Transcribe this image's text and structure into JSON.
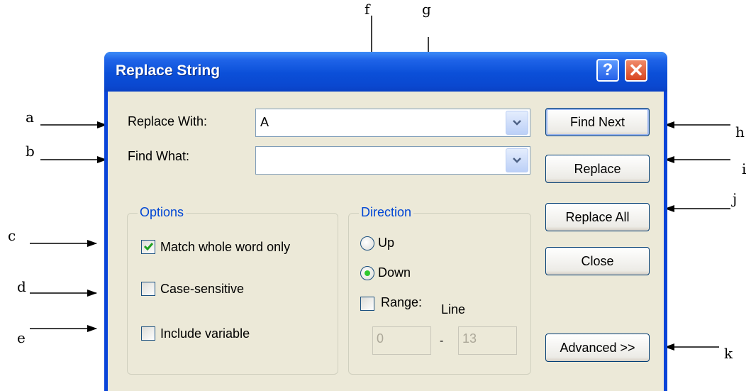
{
  "dialog": {
    "title": "Replace String",
    "help_label": "?",
    "close_label": "✕"
  },
  "fields": {
    "replace_with_label": "Replace With:",
    "replace_with_value": "A",
    "find_what_label": "Find What:",
    "find_what_value": ""
  },
  "options": {
    "legend": "Options",
    "match_whole_word": {
      "label": "Match whole word only",
      "checked": true
    },
    "case_sensitive": {
      "label": "Case-sensitive",
      "checked": false
    },
    "include_variable": {
      "label": "Include variable",
      "checked": false
    }
  },
  "direction": {
    "legend": "Direction",
    "up_label": "Up",
    "down_label": "Down",
    "selected": "Down",
    "range_label": "Range:",
    "line_label": "Line",
    "range_from": "0",
    "range_separator": "-",
    "range_to": "13",
    "range_checked": false
  },
  "buttons": {
    "find_next": "Find Next",
    "replace": "Replace",
    "replace_all": "Replace All",
    "close": "Close",
    "advanced": "Advanced >>"
  },
  "annotations": [
    "a",
    "b",
    "c",
    "d",
    "e",
    "f",
    "g",
    "h",
    "i",
    "j",
    "k"
  ],
  "colors": {
    "titlebar": "#0b4fd8",
    "client": "#ece9d8",
    "group_legend": "#0046d5",
    "check_mark": "#21a121",
    "radio_dot": "#2ec82e",
    "close_button": "#d8451f"
  }
}
